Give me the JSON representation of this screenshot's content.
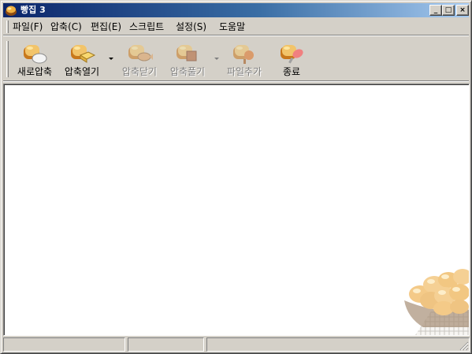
{
  "window": {
    "title": "빵집 3"
  },
  "title_buttons": {
    "minimize": "_",
    "maximize": "□",
    "close": "×"
  },
  "menu": [
    {
      "label": "파일(F)"
    },
    {
      "label": "압축(C)"
    },
    {
      "label": "편집(E)"
    },
    {
      "label": "스크립트"
    },
    {
      "label": "설정(S)"
    },
    {
      "label": "도움말"
    }
  ],
  "toolbar": [
    {
      "label": "새로압축",
      "icon": "new-archive-icon",
      "enabled": true
    },
    {
      "label": "압축열기",
      "icon": "open-archive-icon",
      "enabled": true
    },
    {
      "label": "압축닫기",
      "icon": "close-archive-icon",
      "enabled": false
    },
    {
      "label": "압축풀기",
      "icon": "extract-icon",
      "enabled": false
    },
    {
      "label": "파일추가",
      "icon": "add-file-icon",
      "enabled": false
    },
    {
      "label": "종료",
      "icon": "exit-icon",
      "enabled": true
    }
  ],
  "colors": {
    "titlebar_start": "#0a246a",
    "titlebar_end": "#a6caf0",
    "face": "#d4d0c8",
    "bread": "#f2c46a"
  },
  "statusbar": {
    "panel1": "",
    "panel2": "",
    "panel3": ""
  }
}
